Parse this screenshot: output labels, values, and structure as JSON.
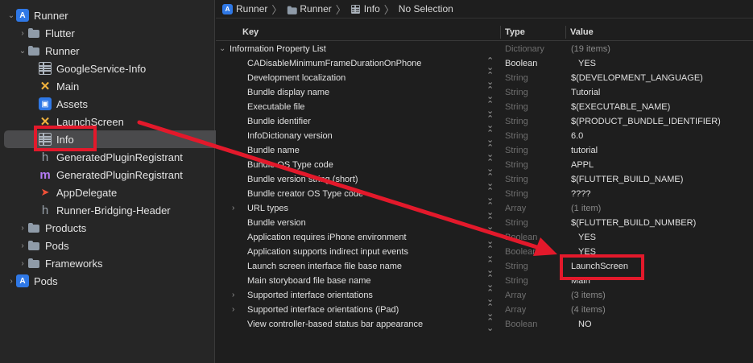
{
  "navigator": {
    "items": [
      {
        "label": "Runner",
        "icon": "project-icon",
        "disclosure": "open"
      },
      {
        "label": "Flutter",
        "icon": "folder-icon",
        "disclosure": "closed"
      },
      {
        "label": "Runner",
        "icon": "folder-icon",
        "disclosure": "open"
      },
      {
        "label": "GoogleService-Info",
        "icon": "plist-icon",
        "disclosure": ""
      },
      {
        "label": "Main",
        "icon": "storyboard-icon",
        "disclosure": ""
      },
      {
        "label": "Assets",
        "icon": "asset-catalog-icon",
        "disclosure": ""
      },
      {
        "label": "LaunchScreen",
        "icon": "storyboard-icon",
        "disclosure": ""
      },
      {
        "label": "Info",
        "icon": "plist-icon",
        "disclosure": "",
        "selected": true
      },
      {
        "label": "GeneratedPluginRegistrant",
        "icon": "header-file-icon",
        "disclosure": ""
      },
      {
        "label": "GeneratedPluginRegistrant",
        "icon": "objc-file-icon",
        "disclosure": ""
      },
      {
        "label": "AppDelegate",
        "icon": "swift-file-icon",
        "disclosure": ""
      },
      {
        "label": "Runner-Bridging-Header",
        "icon": "header-file-icon",
        "disclosure": ""
      },
      {
        "label": "Products",
        "icon": "folder-icon",
        "disclosure": "closed"
      },
      {
        "label": "Pods",
        "icon": "folder-icon",
        "disclosure": "closed"
      },
      {
        "label": "Frameworks",
        "icon": "folder-icon",
        "disclosure": "closed"
      },
      {
        "label": "Pods",
        "icon": "project-icon",
        "disclosure": "closed"
      }
    ]
  },
  "jumpbar": {
    "crumbs": [
      "Runner",
      "Runner",
      "Info",
      "No Selection"
    ]
  },
  "table": {
    "headers": {
      "key": "Key",
      "type": "Type",
      "value": "Value"
    },
    "rows": [
      {
        "key": "Information Property List",
        "type": "Dictionary",
        "value": "(19 items)"
      },
      {
        "key": "CADisableMinimumFrameDurationOnPhone",
        "type": "Boolean",
        "value": "YES"
      },
      {
        "key": "Development localization",
        "type": "String",
        "value": "$(DEVELOPMENT_LANGUAGE)"
      },
      {
        "key": "Bundle display name",
        "type": "String",
        "value": "Tutorial"
      },
      {
        "key": "Executable file",
        "type": "String",
        "value": "$(EXECUTABLE_NAME)"
      },
      {
        "key": "Bundle identifier",
        "type": "String",
        "value": "$(PRODUCT_BUNDLE_IDENTIFIER)"
      },
      {
        "key": "InfoDictionary version",
        "type": "String",
        "value": "6.0"
      },
      {
        "key": "Bundle name",
        "type": "String",
        "value": "tutorial"
      },
      {
        "key": "Bundle OS Type code",
        "type": "String",
        "value": "APPL"
      },
      {
        "key": "Bundle version string (short)",
        "type": "String",
        "value": "$(FLUTTER_BUILD_NAME)"
      },
      {
        "key": "Bundle creator OS Type code",
        "type": "String",
        "value": "????"
      },
      {
        "key": "URL types",
        "type": "Array",
        "value": "(1 item)"
      },
      {
        "key": "Bundle version",
        "type": "String",
        "value": "$(FLUTTER_BUILD_NUMBER)"
      },
      {
        "key": "Application requires iPhone environment",
        "type": "Boolean",
        "value": "YES"
      },
      {
        "key": "Application supports indirect input events",
        "type": "Boolean",
        "value": "YES"
      },
      {
        "key": "Launch screen interface file base name",
        "type": "String",
        "value": "LaunchScreen"
      },
      {
        "key": "Main storyboard file base name",
        "type": "String",
        "value": "Main"
      },
      {
        "key": "Supported interface orientations",
        "type": "Array",
        "value": "(3 items)"
      },
      {
        "key": "Supported interface orientations (iPad)",
        "type": "Array",
        "value": "(4 items)"
      },
      {
        "key": "View controller-based status bar appearance",
        "type": "Boolean",
        "value": "NO"
      }
    ]
  },
  "colors": {
    "annotation": "#e3192b",
    "selection": "#4a4a4c",
    "accent": "#2f78e6"
  }
}
